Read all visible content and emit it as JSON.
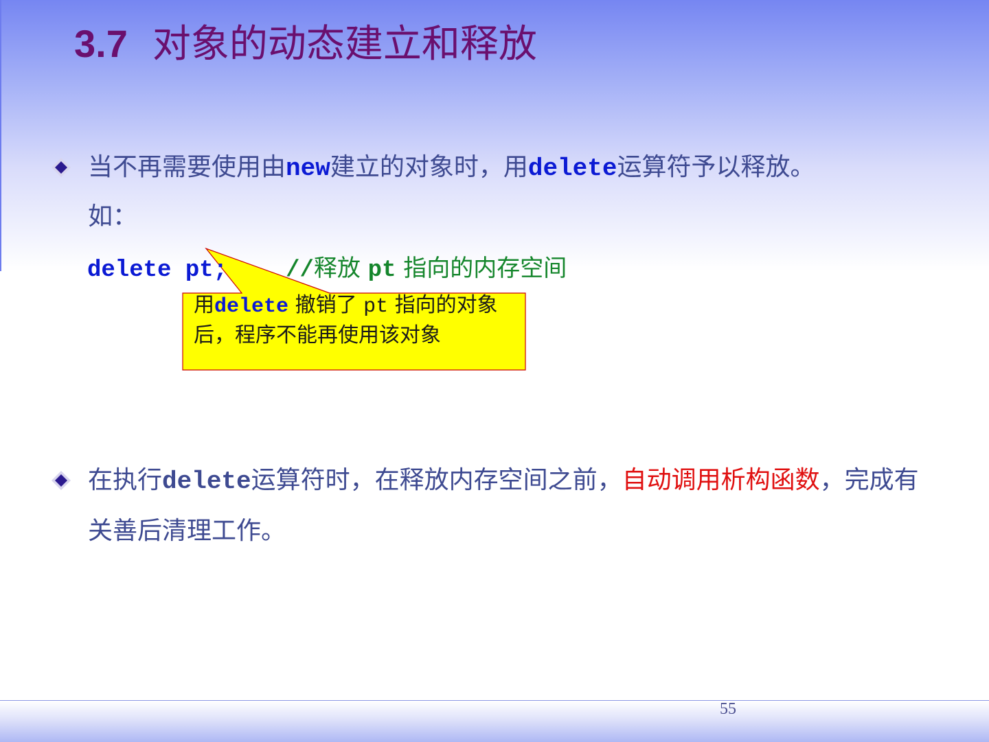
{
  "slide": {
    "number_label": "3.7",
    "title": "对象的动态建立和释放",
    "page_number": "55"
  },
  "bullet1": {
    "text_a": "当不再需要使用由",
    "kw_new": "new",
    "text_b": "建立的对象时，用",
    "kw_delete": "delete",
    "text_c": "运算符予以释放。",
    "text_d": "如："
  },
  "code": {
    "statement": "delete pt;",
    "comment_prefix": "//",
    "comment_a": "释放",
    "comment_pt": "pt",
    "comment_b": "指向的内存空间"
  },
  "callout": {
    "text_a": "用",
    "kw_delete": "delete",
    "text_b": "撤销了",
    "kw_pt": "pt",
    "text_c": "指向的对象后，程序不能再使用该对象",
    "fill_color": "#ffff00",
    "border_color": "#cc0000"
  },
  "bullet2": {
    "text_a": "在执行",
    "kw_delete": "delete",
    "text_b": "运算符时，在释放内存空间之前，",
    "highlight": "自动调用析构函数",
    "text_c": "，完成有关善后清理工作。"
  },
  "colors": {
    "title": "#6a0f6e",
    "body_text": "#3e4a91",
    "keyword": "#0b1ad4",
    "comment": "#15862c",
    "highlight": "#e01010",
    "bullet_diamond": "#2b1a8f"
  },
  "icons": {
    "bullet": "diamond-bullet-icon"
  }
}
